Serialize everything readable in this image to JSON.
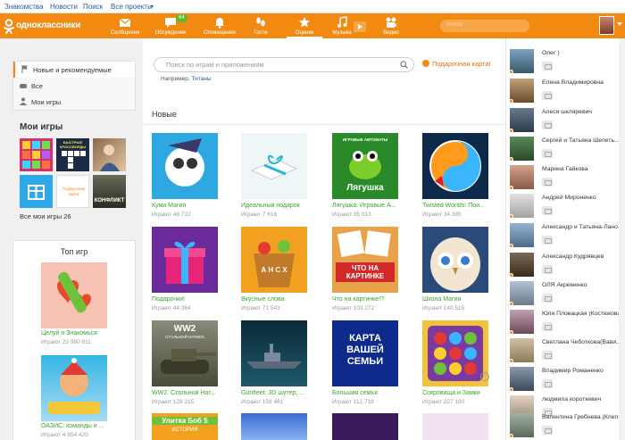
{
  "topbar": {
    "links": [
      "Знакомства",
      "Новости",
      "Поиск",
      "Все проекты"
    ]
  },
  "navbar": {
    "logo_text": "одноклассники",
    "items": [
      {
        "label": "Сообщения",
        "icon": "envelope-icon"
      },
      {
        "label": "Обсуждения",
        "icon": "chat-icon",
        "badge": "64"
      },
      {
        "label": "Оповещения",
        "icon": "bell-icon"
      },
      {
        "label": "Гости",
        "icon": "footprints-icon"
      },
      {
        "label": "Оценки",
        "icon": "star-icon"
      },
      {
        "label": "Музыка",
        "icon": "music-icon"
      },
      {
        "label": "Видео",
        "icon": "video-icon"
      }
    ],
    "search_placeholder": "поиск",
    "accent": "#f28a12"
  },
  "sidebar": {
    "menu": [
      "Новые и рекомендуемые",
      "Все",
      "Мои игры"
    ],
    "my_games_title": "Мои игры",
    "my_games_all": "Все мои игры 26"
  },
  "top_games": {
    "title": "Топ игр",
    "games": [
      {
        "name": "Целуй и Знакомься",
        "players": "Играют 23 980 911"
      },
      {
        "name": "ОАЗИС: команды и ...",
        "players": "Играют 4 954 420"
      }
    ]
  },
  "main": {
    "search_placeholder": "Поиск по играм и приложениям",
    "gift_link": "Подарочная карта!",
    "example_prefix": "Например,",
    "example_value": "Титаны",
    "section_title": "Новые",
    "games": [
      {
        "name": "Куми Магия",
        "players": "Играют 48 722"
      },
      {
        "name": "Идеальный подарок",
        "players": "Играют 7 616"
      },
      {
        "name": "Лягушка: Игровые А...",
        "players": "Играют 35 013"
      },
      {
        "name": "Twisted Worlds: Пои...",
        "players": "Играют 34 385"
      },
      {
        "name": "Подарочки!",
        "players": "Играют 44 364"
      },
      {
        "name": "Вкусные слова",
        "players": "Играют 71 543"
      },
      {
        "name": "Что на картинке!?",
        "players": "Играют 103 272"
      },
      {
        "name": "Школа Магии",
        "players": "Играют 140 515"
      },
      {
        "name": "WW2: Стальной Нат...",
        "players": "Играют 128 215"
      },
      {
        "name": "Gunfleet: 3D шутер, ...",
        "players": "Играют 159 461"
      },
      {
        "name": "Большая семья",
        "players": "Играют 112 718"
      },
      {
        "name": "Сокровища и Замки",
        "players": "Играют 227 180"
      }
    ],
    "tile_texts": {
      "frog": "Лягушка",
      "frog_top": "ИГРОВЫЕ АВТОМАТЫ",
      "guess": "ЧТО НА КАРТИНКЕ",
      "ww2": "WW2",
      "ww2_sub": "СТАЛЬНОЙ НАТИСК",
      "family": "КАРТА ВАШЕЙ СЕМЬИ",
      "words": "А Н С Х",
      "bottom1": "Улитка Боб 5",
      "bottom1_sub": "ИСТОРИЯ"
    }
  },
  "my_game_tiles": {
    "t2_text": "БЫСТРЫЕ КРОССВОРДЫ",
    "t6_text": "КОНФЛИКТ",
    "t5_text": "Подарочная карта"
  },
  "friends": [
    "Олег )",
    "Елена Владимировна",
    "Алеся шкляревич",
    "Сергей и Татьяна Шепеть...",
    "Марина Гайкова",
    "Андрей Мироненко",
    "Александр и Татьяна-Лано...",
    "Александр Кудрявцев",
    "ОЛЯ Акременко",
    "Юля Пловацкая (Костюкова)",
    "Светлана Чеботкова(Вави...",
    "Владимир Романенко",
    "людмила короткевич",
    "Валентина Гребнева (Клеп..."
  ]
}
